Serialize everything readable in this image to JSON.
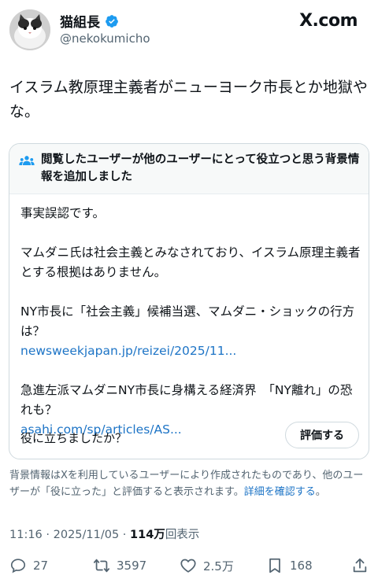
{
  "author": {
    "display_name": "猫組長",
    "handle": "@nekokumicho"
  },
  "site": {
    "brand": "X.com"
  },
  "tweet": {
    "text": "イスラム教原理主義者がニューヨーク市長とか地獄やな。"
  },
  "community_note": {
    "header": "閲覧したユーザーが他のユーザーにとって役立つと思う背景情報を追加しました",
    "paragraphs": [
      {
        "text": "事実誤認です。",
        "link": ""
      },
      {
        "text": "マムダニ氏は社会主義とみなされており、イスラム原理主義者とする根拠はありません。",
        "link": ""
      },
      {
        "text": "NY市長に「社会主義」候補当選、マムダニ・ショックの行方は？",
        "link": "newsweekjapan.jp/reizei/2025/11..."
      },
      {
        "text": "急進左派マムダニNY市長に身構える経済界　「NY離れ」の恐れも？",
        "link": "asahi.com/sp/articles/AS..."
      }
    ],
    "helpful_question": "役に立ちましたか？",
    "rate_button": "評価する"
  },
  "disclaimer": {
    "text": "背景情報はXを利用しているユーザーにより作成されたものであり、他のユーザーが「役に立った」と評価すると表示されます。",
    "more_link": "詳細を確認する",
    "tail": "。"
  },
  "meta": {
    "time": "11:16",
    "separator": " · ",
    "date": "2025/11/05",
    "views_count": "114万",
    "views_label": "回表示"
  },
  "actions": {
    "reply_count": "27",
    "retweet_count": "3597",
    "like_count": "2.5万",
    "bookmark_count": "168"
  },
  "colors": {
    "link": "#1d74c6",
    "verified": "#1d9bf0",
    "secondary_text": "#536471"
  },
  "icons": [
    "avatar-cat",
    "verified-badge-icon",
    "x-logo-icon",
    "people-icon",
    "reply-icon",
    "retweet-icon",
    "like-icon",
    "bookmark-icon",
    "share-icon"
  ]
}
